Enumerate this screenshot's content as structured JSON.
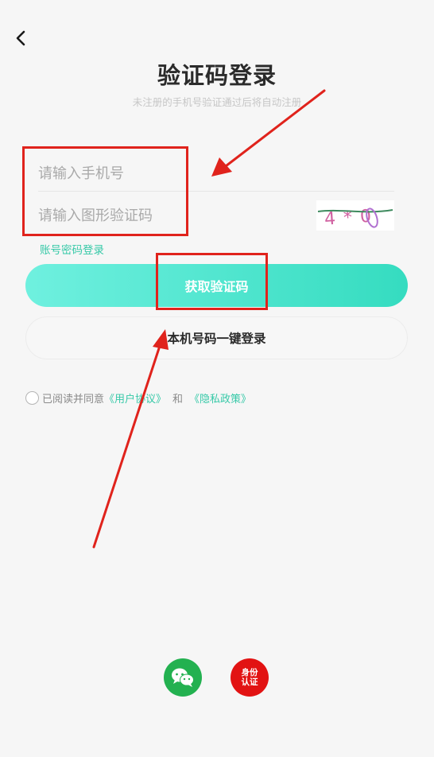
{
  "header": {
    "title": "验证码登录",
    "subtitle": "未注册的手机号验证通过后将自动注册"
  },
  "form": {
    "phone_placeholder": "请输入手机号",
    "captcha_placeholder": "请输入图形验证码",
    "captcha_image_text": "4*0",
    "password_login_link": "账号密码登录",
    "get_code_button": "获取验证码",
    "one_click_login_button": "本机号码一键登录"
  },
  "agreement": {
    "prefix": "已阅读并同意",
    "user_agreement": "《用户协议》",
    "and": "和",
    "privacy_policy": "《隐私政策》"
  },
  "third_party": {
    "wechat_icon": "wechat-icon",
    "id_auth_text_line1": "身份",
    "id_auth_text_line2": "认证"
  },
  "colors": {
    "accent": "#37c9a8",
    "button_gradient_start": "#6ff0df",
    "button_gradient_end": "#35dcc0",
    "annotation_red": "#e0231c",
    "wechat_green": "#23b150",
    "id_red": "#e21313"
  }
}
